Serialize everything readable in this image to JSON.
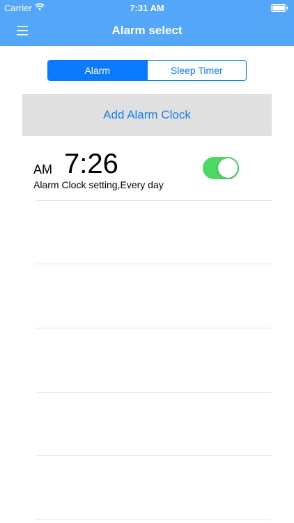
{
  "status_bar": {
    "carrier": "Carrier",
    "time": "7:31 AM",
    "wifi_icon": "wifi-icon",
    "battery_icon": "battery-icon"
  },
  "nav": {
    "title": "Alarm select",
    "menu_icon": "hamburger-menu-icon"
  },
  "tabs": [
    {
      "label": "Alarm",
      "selected": true
    },
    {
      "label": "Sleep Timer",
      "selected": false
    }
  ],
  "add_button": {
    "label": "Add Alarm Clock"
  },
  "alarms": [
    {
      "ampm": "AM",
      "time": "7:26",
      "description": "Alarm Clock setting,Every day",
      "enabled": true
    }
  ],
  "colors": {
    "nav_background": "#54a6f8",
    "accent": "#0a7bff",
    "toggle_on": "#4cd964",
    "add_button_bg": "#e0e0e0",
    "add_button_text": "#1a7ee8"
  }
}
